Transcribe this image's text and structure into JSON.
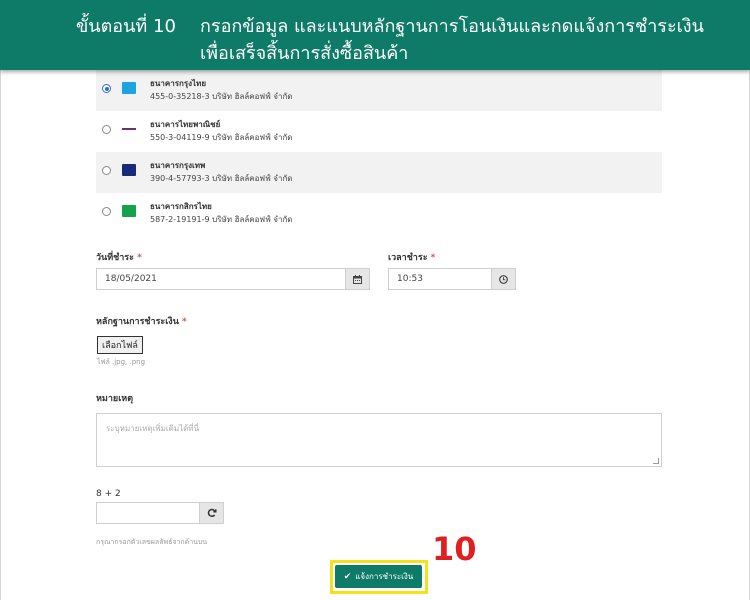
{
  "banner": {
    "step_label": "ขั้นตอนที่ 10",
    "title_line1": "กรอกข้อมูล และแนบหลักฐานการโอนเงินและกดแจ้งการชำระเงิน",
    "title_line2": "เพื่อเสร็จสิ้นการสั่งซื้อสินค้า"
  },
  "banks": [
    {
      "name": "ธนาคารกรุงไทย",
      "account": "455-0-35218-3 บริษัท ฮิลล์คอฟฟ์ จำกัด",
      "selected": true,
      "logo_color": "#1ba5e0",
      "icon": "ktb-logo"
    },
    {
      "name": "ธนาคารไทยพาณิชย์",
      "account": "550-3-04119-9 บริษัท ฮิลล์คอฟฟ์ จำกัด",
      "selected": false,
      "logo_color": "#6b2e82",
      "icon": "scb-logo"
    },
    {
      "name": "ธนาคารกรุงเทพ",
      "account": "390-4-57793-3 บริษัท ฮิลล์คอฟฟ์ จำกัด",
      "selected": false,
      "logo_color": "#1a2a7a",
      "icon": "bbl-logo"
    },
    {
      "name": "ธนาคารกสิกรไทย",
      "account": "587-2-19191-9 บริษัท ฮิลล์คอฟฟ์ จำกัด",
      "selected": false,
      "logo_color": "#13a34c",
      "icon": "kbank-logo"
    }
  ],
  "payment_date": {
    "label": "วันที่ชำระ",
    "value": "18/05/2021",
    "icon": "calendar-icon"
  },
  "payment_time": {
    "label": "เวลาชำระ",
    "value": "10:53",
    "icon": "clock-icon"
  },
  "required_mark": "*",
  "proof": {
    "label": "หลักฐานการชำระเงิน",
    "button": "เลือกไฟล์",
    "hint": "ไฟล์ .jpg, .png"
  },
  "note": {
    "label": "หมายเหตุ",
    "placeholder": "ระบุหมายเหตุเพิ่มเติมได้ที่นี่"
  },
  "captcha": {
    "question": "8 + 2",
    "value": "",
    "hint": "กรุณากรอกตัวเลขผลลัพธ์จากด้านบน",
    "icon": "refresh-icon"
  },
  "submit": {
    "label": "แจ้งการชำระเงิน",
    "icon": "check-icon"
  },
  "step_number": "10",
  "colors": {
    "brand": "#0e7a68",
    "highlight": "#f4e21a",
    "step_number": "#e02020",
    "required": "#d9534f"
  }
}
